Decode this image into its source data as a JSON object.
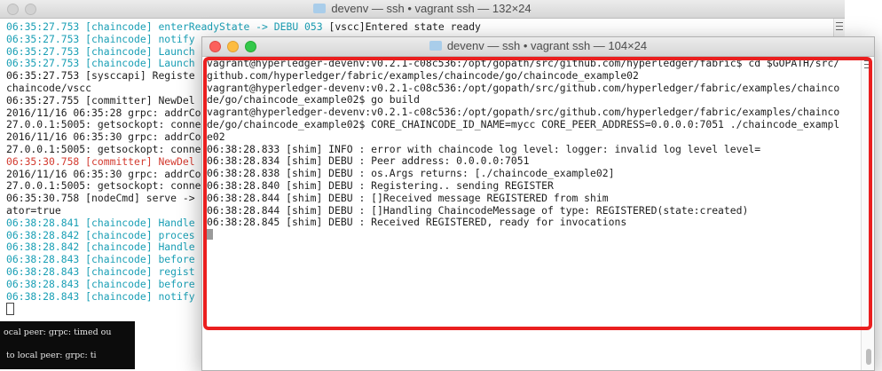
{
  "back_window": {
    "title": "devenv — ssh • vagrant ssh — 132×24",
    "lines": [
      {
        "text": "06:35:27.753 [chaincode] enterReadyState -> DEBU 053 [vscc]Entered state ready",
        "color": "cyan-black"
      },
      {
        "text": "06:35:27.753 [chaincode] notify",
        "color": "cyan"
      },
      {
        "text": "06:35:27.753 [chaincode] Launch",
        "color": "cyan"
      },
      {
        "text": "06:35:27.753 [chaincode] Launch",
        "color": "cyan"
      },
      {
        "text": "06:35:27.753 [sysccapi] Registe",
        "color": "black"
      },
      {
        "text": "chaincode/vscc",
        "color": "black"
      },
      {
        "text": "06:35:27.755 [committer] NewDel",
        "color": "black"
      },
      {
        "text": "2016/11/16 06:35:28 grpc: addrCo",
        "color": "black"
      },
      {
        "text": "27.0.0.1:5005: getsockopt: conne",
        "color": "black"
      },
      {
        "text": "2016/11/16 06:35:30 grpc: addrCo",
        "color": "black"
      },
      {
        "text": "27.0.0.1:5005: getsockopt: conne",
        "color": "black"
      },
      {
        "text": "06:35:30.758 [committer] NewDel",
        "color": "red"
      },
      {
        "text": "2016/11/16 06:35:30 grpc: addrCo",
        "color": "black"
      },
      {
        "text": "27.0.0.1:5005: getsockopt: conne",
        "color": "black"
      },
      {
        "text": "06:35:30.758 [nodeCmd] serve ->",
        "color": "black"
      },
      {
        "text": "ator=true",
        "color": "black"
      },
      {
        "text": "06:38:28.841 [chaincode] Handle",
        "color": "cyan"
      },
      {
        "text": "06:38:28.842 [chaincode] proces",
        "color": "cyan"
      },
      {
        "text": "06:38:28.842 [chaincode] Handle",
        "color": "cyan"
      },
      {
        "text": "06:38:28.843 [chaincode] before",
        "color": "cyan"
      },
      {
        "text": "06:38:28.843 [chaincode] regist",
        "color": "cyan"
      },
      {
        "text": "06:38:28.843 [chaincode] before",
        "color": "cyan"
      },
      {
        "text": "06:38:28.843 [chaincode] notify",
        "color": "cyan"
      }
    ],
    "first_line_cyan_part": "06:35:27.753 [chaincode] enterReadyState -> DEBU 053",
    "first_line_black_part": " [vscc]Entered state ready"
  },
  "dark_region": {
    "lines": [
      "ocal peer: grpc: timed ou",
      " to local peer: grpc: ti"
    ]
  },
  "front_window": {
    "title": "devenv — ssh • vagrant ssh — 104×24",
    "lines": [
      "vagrant@hyperledger-devenv:v0.2.1-c08c536:/opt/gopath/src/github.com/hyperledger/fabric$ cd $GOPATH/src/",
      "github.com/hyperledger/fabric/examples/chaincode/go/chaincode_example02",
      "vagrant@hyperledger-devenv:v0.2.1-c08c536:/opt/gopath/src/github.com/hyperledger/fabric/examples/chainco",
      "de/go/chaincode_example02$ go build",
      "vagrant@hyperledger-devenv:v0.2.1-c08c536:/opt/gopath/src/github.com/hyperledger/fabric/examples/chainco",
      "de/go/chaincode_example02$ CORE_CHAINCODE_ID_NAME=mycc CORE_PEER_ADDRESS=0.0.0.0:7051 ./chaincode_exampl",
      "e02",
      "06:38:28.833 [shim] INFO : error with chaincode log level: logger: invalid log level level=",
      "06:38:28.834 [shim] DEBU : Peer address: 0.0.0.0:7051",
      "06:38:28.838 [shim] DEBU : os.Args returns: [./chaincode_example02]",
      "06:38:28.840 [shim] DEBU : Registering.. sending REGISTER",
      "06:38:28.844 [shim] DEBU : []Received message REGISTERED from shim",
      "06:38:28.844 [shim] DEBU : []Handling ChaincodeMessage of type: REGISTERED(state:created)",
      "06:38:28.845 [shim] DEBU : Received REGISTERED, ready for invocations"
    ]
  },
  "colors": {
    "cyan": "#1a9fb5",
    "red": "#d33a2f",
    "highlight": "#ea1f1f"
  }
}
